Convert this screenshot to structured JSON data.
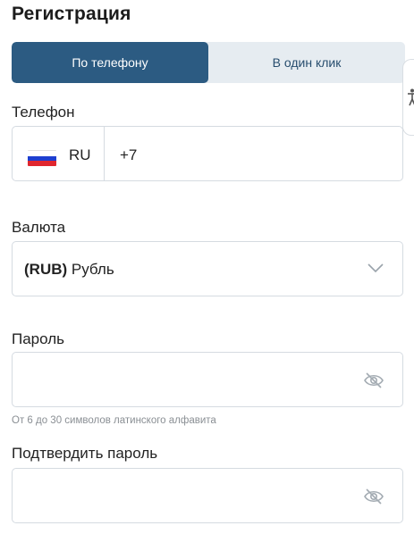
{
  "title": "Регистрация",
  "tabs": [
    {
      "label": "По телефону",
      "active": true
    },
    {
      "label": "В один клик",
      "active": false
    }
  ],
  "phone": {
    "label": "Телефон",
    "country_code": "RU",
    "prefix": "+7",
    "flag_icon": "russia-flag-icon",
    "flag_colors": [
      "#ffffff",
      "#1e3fd0",
      "#e0262e"
    ]
  },
  "currency": {
    "label": "Валюта",
    "code": "(RUB)",
    "name": "Рубль",
    "icon": "chevron-down-icon"
  },
  "password": {
    "label": "Пароль",
    "value": "",
    "hint": "От 6 до 30 символов латинского алфавита",
    "icon": "eye-off-icon"
  },
  "confirm_password": {
    "label": "Подтвердить пароль",
    "value": "",
    "icon": "eye-off-icon"
  },
  "accessibility": {
    "icon": "accessibility-icon"
  },
  "colors": {
    "accent": "#2c5b82",
    "tab_bg": "#e6ecf1",
    "border": "#d5dbe1"
  }
}
